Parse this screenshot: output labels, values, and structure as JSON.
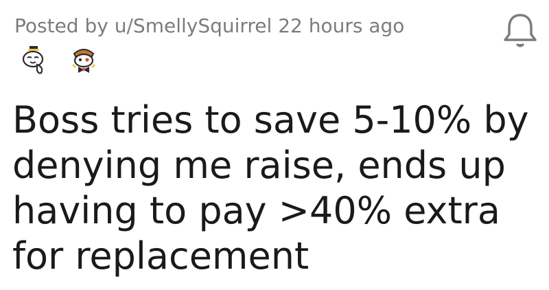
{
  "post": {
    "posted_by_prefix": "Posted by",
    "username": "u/SmellySquirrel",
    "timestamp": "22 hours ago",
    "title": "Boss tries to save 5-10% by denying me raise, ends up having to pay >40% extra for replacement",
    "awards": [
      {
        "icon": "wholesome-seal-icon"
      },
      {
        "icon": "tophat-award-icon"
      }
    ],
    "notification_icon": "bell-icon"
  },
  "colors": {
    "meta_text": "#7c7c7c",
    "title_text": "#1a1a1b",
    "icon_stroke": "#7c7c7c"
  }
}
